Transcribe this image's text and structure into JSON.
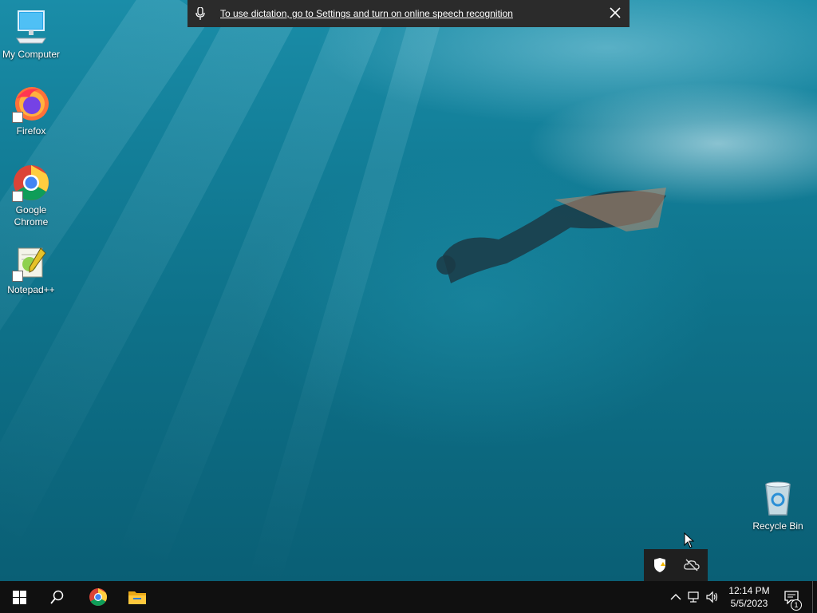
{
  "desktop": {
    "icons": [
      {
        "label": "My Computer"
      },
      {
        "label": "Firefox"
      },
      {
        "label": "Google Chrome"
      },
      {
        "label": "Notepad++"
      },
      {
        "label": "Recycle Bin"
      }
    ]
  },
  "dictation": {
    "message": "To use dictation, go to Settings and turn on online speech recognition"
  },
  "taskbar": {
    "clock": {
      "time": "12:14 PM",
      "date": "5/5/2023"
    },
    "notification_count": "1",
    "pinned": [
      "start-icon",
      "search-icon",
      "chrome-icon",
      "file-explorer-icon"
    ]
  },
  "tray_flyout": {
    "icons": [
      "windows-security-warning-icon",
      "onedrive-offline-icon"
    ]
  },
  "colors": {
    "taskbar": "#101010",
    "dictation_bar": "#2b2b2b",
    "desktop": "#0f6f86"
  }
}
